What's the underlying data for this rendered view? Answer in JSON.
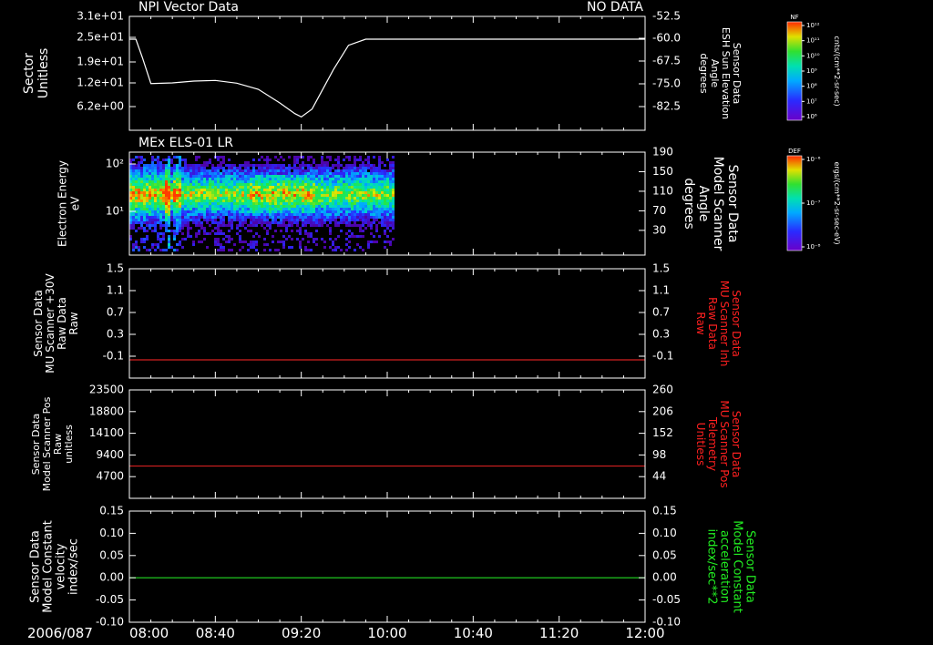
{
  "date_label": "2006/087",
  "time_ticks": [
    "08:00",
    "08:40",
    "09:20",
    "10:00",
    "10:40",
    "11:20",
    "12:00"
  ],
  "colors": {
    "frame": "#ffffff",
    "background": "#000000",
    "red_trace": "#d42020",
    "green_trace": "#22dd22",
    "label_red": "#ff2020",
    "label_green": "#22ee22"
  },
  "chart_data": [
    {
      "type": "line",
      "panel_title_left": "NPI Vector Data",
      "panel_title_right": "NO DATA",
      "ylabel_left": "Sector\nUnitless",
      "yticks_left": [
        "3.1e+01",
        "2.5e+01",
        "1.9e+01",
        "1.2e+01",
        "6.2e+00"
      ],
      "ylabel_right": "Sensor Data\nESH Sun Elevation\nAngle\ndegrees",
      "yticks_right": [
        "-52.5",
        "-60.0",
        "-67.5",
        "-75.0",
        "-82.5"
      ],
      "ylim_right": [
        -90,
        -52.5
      ],
      "series": [
        {
          "x": [
            "08:00",
            "08:03",
            "08:06",
            "08:10",
            "08:20",
            "08:30",
            "08:40",
            "08:50",
            "09:00",
            "09:10",
            "09:17",
            "09:20",
            "09:25",
            "09:35",
            "09:42",
            "09:50",
            "10:40",
            "12:00"
          ],
          "values": [
            -60.0,
            -60.0,
            -66.0,
            -74.6,
            -74.4,
            -73.8,
            -73.6,
            -74.5,
            -76.5,
            -81.0,
            -84.5,
            -85.6,
            -83.0,
            -70.0,
            -62.0,
            -60.0,
            -60.0,
            -60.0
          ]
        }
      ]
    },
    {
      "type": "heatmap",
      "panel_title_left": "MEx ELS-01 LR",
      "ylabel_left": "Electron Energy\neV",
      "yticks_left": [
        "10²",
        "10¹"
      ],
      "ylabel_right": "Sensor Data\nModel Scanner\nAngle\ndegrees",
      "yticks_right": [
        "190",
        "150",
        "110",
        "70",
        "30"
      ],
      "data_extent_x": [
        "08:00",
        "10:03"
      ]
    },
    {
      "type": "line",
      "ylabel_left": "Sensor Data\nMU Scanner +30V\nRaw Data\nRaw",
      "yticks_left": [
        "1.5",
        "1.1",
        "0.7",
        "0.3",
        "-0.1"
      ],
      "ylabel_right": "Sensor Data\nMU Scanner Inh\nRaw Data\nRaw",
      "yticks_right": [
        "1.5",
        "1.1",
        "0.7",
        "0.3",
        "-0.1"
      ],
      "ylim": [
        -0.3,
        1.5
      ],
      "series": [
        {
          "x": [
            "08:00",
            "12:00"
          ],
          "values": [
            0.0,
            0.0
          ]
        }
      ]
    },
    {
      "type": "line",
      "ylabel_left": "Sensor Data\nModel Scanner Pos\nRaw\nunitless",
      "yticks_left": [
        "23500",
        "18800",
        "14100",
        "9400",
        "4700"
      ],
      "ylabel_right": "Sensor Data\nMU Scanner Pos\nTelemetry\nUnitless",
      "yticks_right": [
        "260",
        "206",
        "152",
        "98",
        "44"
      ],
      "ylim": [
        0,
        23500
      ],
      "series": [
        {
          "x": [
            "08:00",
            "12:00"
          ],
          "values": [
            7000,
            7000
          ]
        }
      ]
    },
    {
      "type": "line",
      "ylabel_left": "Sensor Data\nModel Constant\nvelocity\nindex/sec",
      "yticks_left": [
        "0.15",
        "0.10",
        "0.05",
        "0.00",
        "-0.05",
        "-0.10"
      ],
      "ylabel_right": "Sensor Data\nModel Constant\nacceleration\nindex/sec**2",
      "yticks_right": [
        "0.15",
        "0.10",
        "0.05",
        "0.00",
        "-0.05",
        "-0.10"
      ],
      "ylim": [
        -0.1,
        0.15
      ],
      "series": [
        {
          "x": [
            "08:00",
            "12:00"
          ],
          "values": [
            0.0,
            0.0
          ]
        }
      ]
    }
  ],
  "colorbars": [
    {
      "label_top": "NF",
      "units": "cnts/(cm**2-sr-sec)",
      "ticks": [
        "10¹²",
        "10¹¹",
        "10¹⁰",
        "10⁹",
        "10⁸",
        "10⁷",
        "10⁶"
      ]
    },
    {
      "label_top": "DEF",
      "units": "ergs/(cm**2-sr-sec-eV)",
      "ticks": [
        "10⁻⁶",
        "10⁻⁷",
        "10⁻⁸"
      ]
    }
  ]
}
